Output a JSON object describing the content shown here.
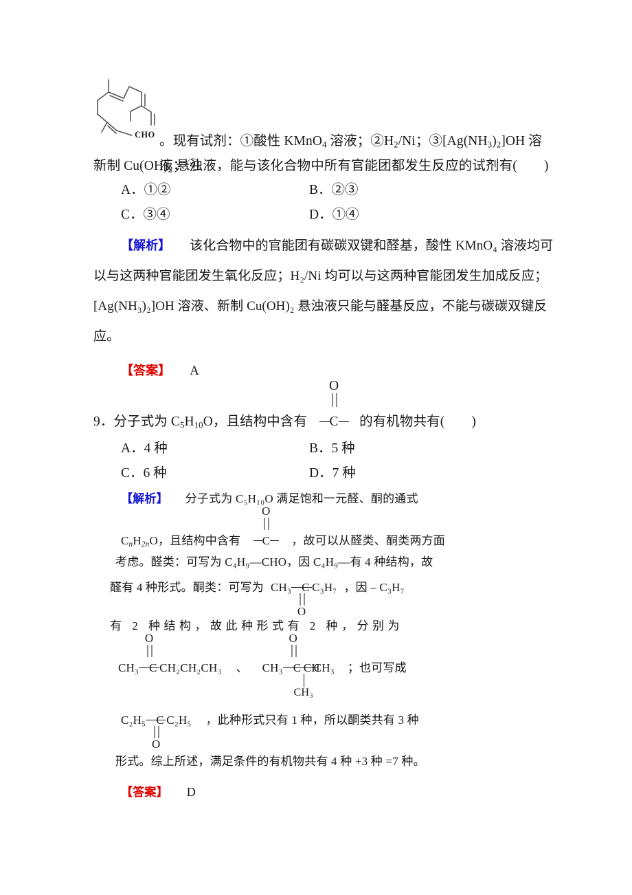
{
  "document": {
    "page_background": "#ffffff",
    "accent_analysis_color": "#1414d2",
    "accent_answer_color": "#e00000"
  },
  "molecule": {
    "name": "farnesal-skeletal-structure",
    "terminal_label": "CHO"
  },
  "question8": {
    "stem_part1": "。现有试剂：①酸性 KMnO",
    "stem_kmno4_sub": "4",
    "stem_part2": " 溶液；②H",
    "stem_h2_sub": "2",
    "stem_part3": "/Ni；③[Ag(NH",
    "stem_nh3_sub": "3",
    "stem_part4": ")",
    "stem_ag_sub": "2",
    "stem_part5": "]OH 溶液；④",
    "line2_part1": "新制 Cu(OH)",
    "line2_sub": "2",
    "line2_part2": " 悬浊液，能与该化合物中所有官能团都发生反应的试剂有(　　)",
    "options": [
      {
        "key": "A",
        "label": "A．①②"
      },
      {
        "key": "B",
        "label": "B．②③"
      },
      {
        "key": "C",
        "label": "C．③④"
      },
      {
        "key": "D",
        "label": "D．①④"
      }
    ],
    "analysis_tag": "【解析】",
    "analysis_lines": [
      "该化合物中的官能团有碳碳双键和醛基，酸性 KMnO₄ 溶液均可",
      "以与这两种官能团发生氧化反应；H₂/Ni 均可以与这两种官能团发生加成反应；",
      "[Ag(NH₃)₂]OH 溶液、新制 Cu(OH)₂ 悬浊液只能与醛基反应，不能与碳碳双键反",
      "应。"
    ],
    "answer_tag": "【答案】",
    "answer_value": "A"
  },
  "question9": {
    "number": "9．",
    "stem_part1": "分子式为 C",
    "stem_c_sub": "5",
    "stem_h": "H",
    "stem_h_sub": "10",
    "stem_o": "O，且结构中含有",
    "stem_part2": "的有机物共有(　　)",
    "carbonyl_o": "O",
    "carbonyl_c": "C",
    "options": [
      {
        "key": "A",
        "label": "A．4 种"
      },
      {
        "key": "B",
        "label": "B．5 种"
      },
      {
        "key": "C",
        "label": "C．6 种"
      },
      {
        "key": "D",
        "label": "D．7 种"
      }
    ],
    "analysis_tag": "【解析】",
    "analysis": {
      "l1": "分子式为 C₅H₁₀O 满足饱和一元醛、酮的通式",
      "l2_pre": "C",
      "l2_n": "n",
      "l2_h": "H",
      "l2_2n": "2n",
      "l2_o": "O，且结构中含有",
      "l2_post": "，故可以从醛类、酮类两方面",
      "l3": "考虑。醛类：可写为 C₄H₉—CHO，因 C₄H₉—有 4 种结构，故",
      "l4_pre": "醛有 4 种形式。酮类：可写为",
      "l4_ketone_left": "CH₃",
      "l4_ketone_c": "C",
      "l4_ketone_right": "C₃H₇",
      "l4_ketone_o": "O",
      "l4_post": "，因 – C₃H₇",
      "l5": "有 2 种结构，故此种形式有 2 种，分别为",
      "struct1": {
        "left": "CH₃",
        "center": "C",
        "top": "O",
        "right": "CH₂CH₂CH₃"
      },
      "separator": "、",
      "struct2": {
        "left": "CH₃",
        "center": "C",
        "top": "O",
        "mid": "CH",
        "right": "CH₃",
        "branch": "CH₃"
      },
      "l6_tail": "；也可写成",
      "struct3": {
        "left": "C₂H₅",
        "center": "C",
        "bottom": "O",
        "right": "C₂H₅"
      },
      "l7_tail": "，此种形式只有 1 种，所以酮类共有 3 种",
      "l8": "形式。综上所述，满足条件的有机物共有 4 种 +3 种 =7 种。"
    },
    "answer_tag": "【答案】",
    "answer_value": "D"
  }
}
